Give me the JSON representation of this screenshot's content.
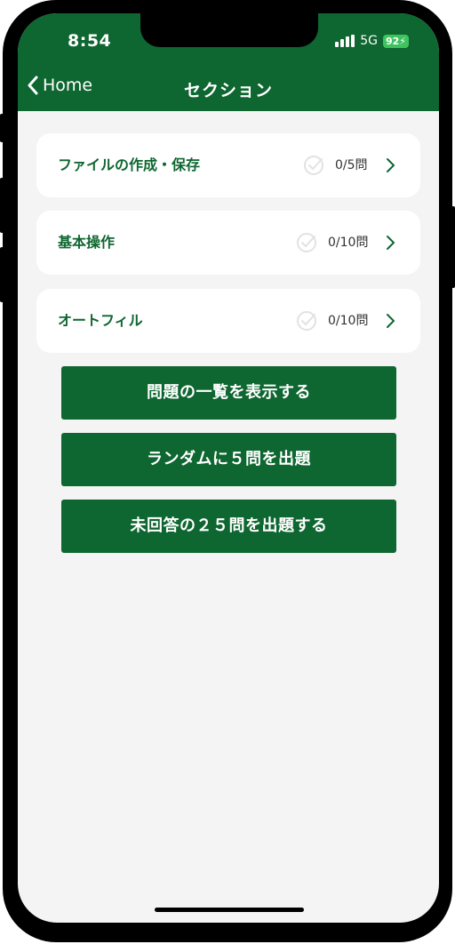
{
  "status_bar": {
    "time": "8:54",
    "network": "5G",
    "battery": "92"
  },
  "nav": {
    "back_label": "Home",
    "title": "セクション"
  },
  "sections": [
    {
      "title": "ファイルの作成・保存",
      "count": "0/5問"
    },
    {
      "title": "基本操作",
      "count": "0/10問"
    },
    {
      "title": "オートフィル",
      "count": "0/10問"
    }
  ],
  "actions": {
    "list_all": "問題の一覧を表示する",
    "random": "ランダムに５問を出題",
    "unanswered": "未回答の２５問を出題する"
  },
  "colors": {
    "primary": "#0e6630",
    "background": "#f4f4f4",
    "battery": "#3fc35f"
  }
}
